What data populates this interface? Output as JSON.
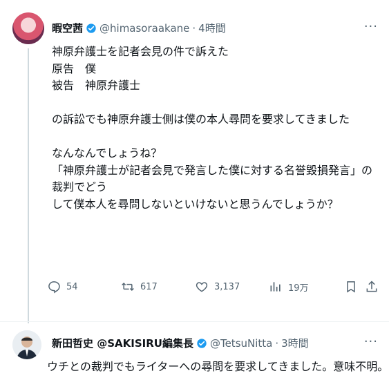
{
  "tweet": {
    "name": "暇空茜",
    "handle": "@himasoraakane",
    "dot": "·",
    "time": "4時間",
    "more": "···",
    "lines": [
      "神原弁護士を記者会見の件で訴えた",
      "原告　僕",
      "被告　神原弁護士",
      "",
      "の訴訟でも神原弁護士側は僕の本人尋問を要求してきました",
      "",
      "なんなんでしょうね？",
      "「神原弁護士が記者会見で発言した僕に対する名誉毀損発言」の裁判でどう",
      "して僕本人を尋問しないといけないと思うんでしょうか？"
    ],
    "stats": {
      "replies": "54",
      "retweets": "617",
      "likes": "3,137",
      "views": "19万"
    }
  },
  "reply": {
    "name": "新田哲史 @SAKISIRU編集長",
    "handle": "@TetsuNitta",
    "dot": "·",
    "time": "3時間",
    "more": "···",
    "text": "ウチとの裁判でもライターへの尋問を要求してきました。意味不明。"
  },
  "colors": {
    "secondary": "#536471",
    "verified": "#1d9bf0",
    "text": "#0f1419"
  }
}
